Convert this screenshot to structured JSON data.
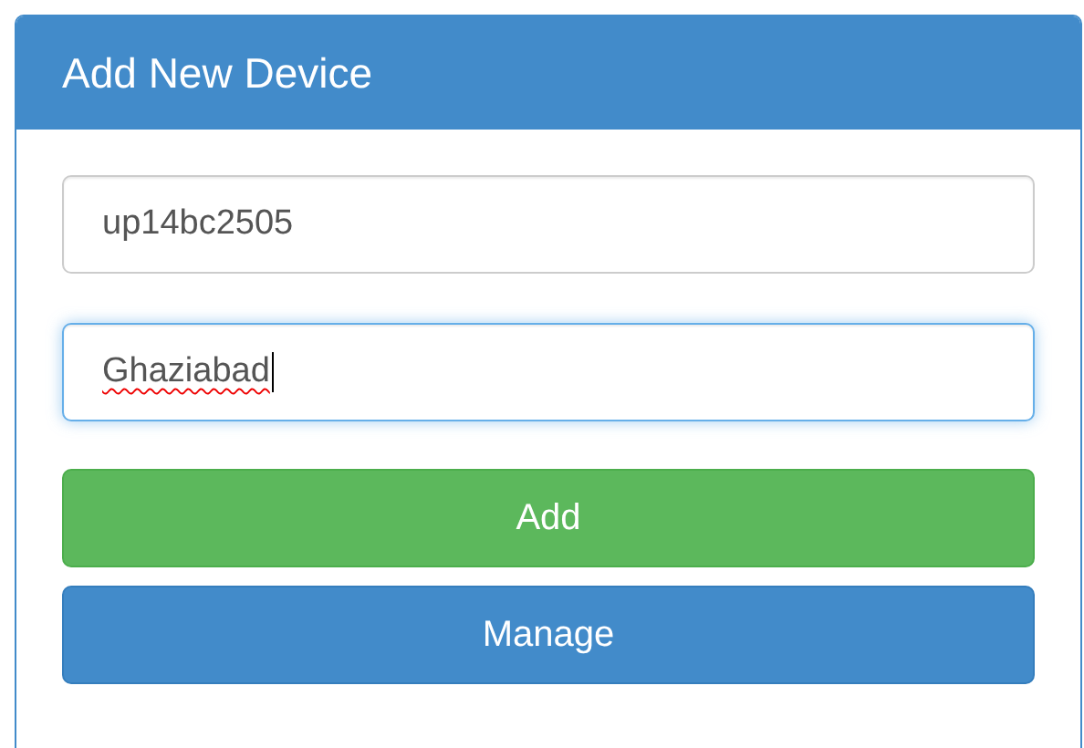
{
  "panel": {
    "title": "Add New Device"
  },
  "fields": [
    {
      "value": "up14bc2505",
      "focused": false,
      "misspelled": false
    },
    {
      "value": "Ghaziabad",
      "focused": true,
      "misspelled": true
    }
  ],
  "buttons": [
    {
      "label": "Add",
      "kind": "success"
    },
    {
      "label": "Manage",
      "kind": "primary"
    }
  ]
}
